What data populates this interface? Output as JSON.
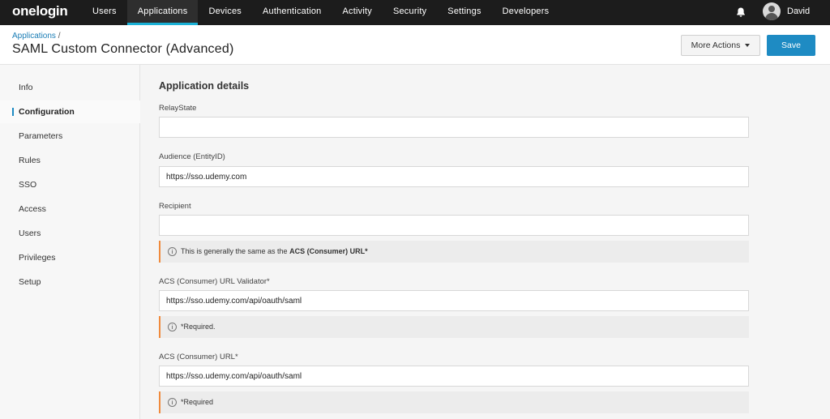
{
  "brand": {
    "logo": "onelogin"
  },
  "nav": [
    {
      "label": "Users",
      "active": false
    },
    {
      "label": "Applications",
      "active": true
    },
    {
      "label": "Devices",
      "active": false
    },
    {
      "label": "Authentication",
      "active": false
    },
    {
      "label": "Activity",
      "active": false
    },
    {
      "label": "Security",
      "active": false
    },
    {
      "label": "Settings",
      "active": false
    },
    {
      "label": "Developers",
      "active": false
    }
  ],
  "user": {
    "name": "David"
  },
  "header": {
    "breadcrumb": "Applications",
    "breadcrumb_sep": "/",
    "title": "SAML Custom Connector (Advanced)",
    "more_actions": "More Actions",
    "save": "Save"
  },
  "sidebar": [
    {
      "label": "Info",
      "active": false
    },
    {
      "label": "Configuration",
      "active": true
    },
    {
      "label": "Parameters",
      "active": false
    },
    {
      "label": "Rules",
      "active": false
    },
    {
      "label": "SSO",
      "active": false
    },
    {
      "label": "Access",
      "active": false
    },
    {
      "label": "Users",
      "active": false
    },
    {
      "label": "Privileges",
      "active": false
    },
    {
      "label": "Setup",
      "active": false
    }
  ],
  "details": {
    "title": "Application details",
    "relay_state": {
      "label": "RelayState",
      "value": ""
    },
    "audience": {
      "label": "Audience (EntityID)",
      "value": "https://sso.udemy.com"
    },
    "recipient": {
      "label": "Recipient",
      "value": "",
      "hint_prefix": "This is generally the same as the ",
      "hint_bold": "ACS (Consumer) URL*"
    },
    "acs_validator": {
      "label": "ACS (Consumer) URL Validator*",
      "value": "https://sso.udemy.com/api/oauth/saml",
      "hint": "*Required."
    },
    "acs_url": {
      "label": "ACS (Consumer) URL*",
      "value": "https://sso.udemy.com/api/oauth/saml",
      "hint": "*Required"
    }
  },
  "icons": {
    "info": "i",
    "bell": "bell-icon",
    "avatar": "user-avatar-icon"
  },
  "colors": {
    "accent": "#1e8bc3",
    "topbar": "#1c1c1c",
    "hint_border": "#f08a3c",
    "nav_underline": "#1ab1d6"
  }
}
